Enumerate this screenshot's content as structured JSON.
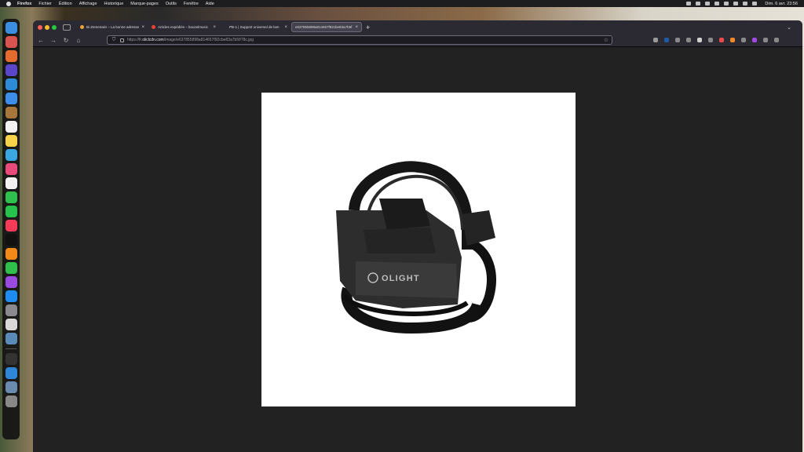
{
  "menubar": {
    "app_name": "Firefox",
    "items": [
      "Fichier",
      "Édition",
      "Affichage",
      "Historique",
      "Marque-pages",
      "Outils",
      "Fenêtre",
      "Aide"
    ],
    "clock": "Dim. 6 avr. 23:56"
  },
  "browser": {
    "tabs": [
      {
        "title": "Bi Zemenwin – La bonne adresse",
        "favicon_color": "#e8a33d",
        "active": false
      },
      {
        "title": "Articles expédiés – bouzelmusic",
        "favicon_color": "#ea4335",
        "active": false
      },
      {
        "title": "PB-1 | Support universel de lam",
        "favicon_color": "#888888",
        "active": false
      },
      {
        "title": "e637855898a814657f92cbe83a7b5f",
        "favicon_color": "#888888",
        "active": true
      }
    ],
    "new_tab_label": "+",
    "url_prefix": "https://fr.",
    "url_host": "oliclcdn.com",
    "url_path": "/image/e637855898a814657f92cbe83a7b5f/78c.jpg"
  },
  "product_image": {
    "logo_text": "OLIGHT"
  },
  "colors": {
    "window_bg": "#222222",
    "toolbar_bg": "#2b2a33",
    "close": "#ff5f57",
    "minimize": "#febc2e",
    "maximize": "#28c840"
  }
}
